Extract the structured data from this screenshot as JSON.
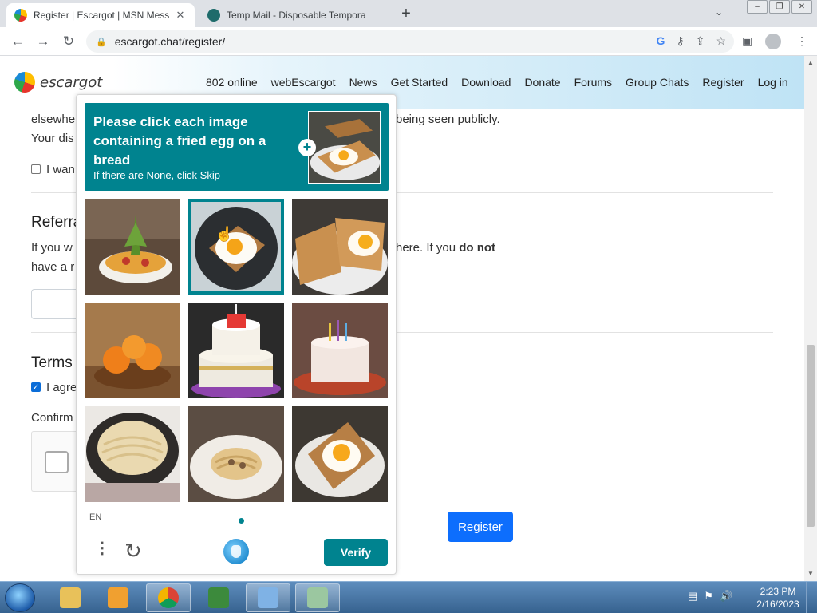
{
  "browser": {
    "tabs": [
      {
        "title": "Register | Escargot | MSN Messe",
        "active": true
      },
      {
        "title": "Temp Mail - Disposable Tempora",
        "active": false
      }
    ],
    "url": "escargot.chat/register/"
  },
  "site": {
    "logo_text": "escargot",
    "nav": [
      "802 online",
      "webEscargot",
      "News",
      "Get Started",
      "Download",
      "Donate",
      "Forums",
      "Group Chats",
      "Register",
      "Log in"
    ]
  },
  "form": {
    "line_1_left": "elsewhe",
    "line_1_right": "being seen publicly.",
    "line_2_left": "Your dis",
    "checkbox_1_label": "I wan",
    "referral_heading": "Referra",
    "referral_text_left": "If you w",
    "referral_text_right": "here. If you",
    "referral_text_bold": "do not",
    "referral_text_line2": "have a r",
    "terms_heading": "Terms",
    "terms_checkbox_label": "I agre",
    "confirm_label": "Confirm",
    "register_button": "Register"
  },
  "captcha": {
    "prompt": "Please click each image containing a fried egg on a bread",
    "subtext": "If there are None, click Skip",
    "language": "EN",
    "verify_button": "Verify",
    "images": [
      {
        "subject": "pizza with pineapple",
        "selected": false
      },
      {
        "subject": "fried egg on toast in pan",
        "selected": true
      },
      {
        "subject": "fried eggs on toast plate",
        "selected": false
      },
      {
        "subject": "oranges in bowl",
        "selected": false
      },
      {
        "subject": "layered cake with candle",
        "selected": false
      },
      {
        "subject": "birthday cake with candles",
        "selected": false
      },
      {
        "subject": "pasta in pan",
        "selected": false
      },
      {
        "subject": "pasta on plate",
        "selected": false
      },
      {
        "subject": "fried egg on toast",
        "selected": false
      }
    ]
  },
  "taskbar": {
    "time": "2:23 PM",
    "date": "2/16/2023"
  },
  "colors": {
    "captcha_teal": "#00838f",
    "register_blue": "#0d6efd"
  }
}
